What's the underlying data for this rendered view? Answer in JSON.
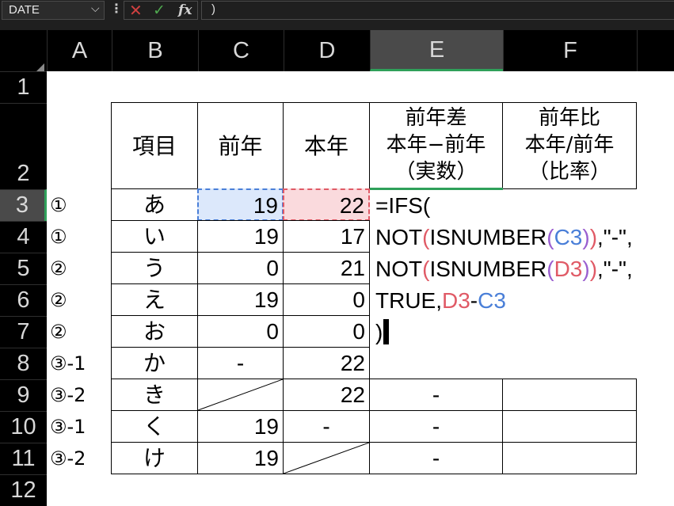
{
  "formula_bar": {
    "name_box": "DATE",
    "name_box_arrow": "⌵",
    "dots": "⋮",
    "cancel": "✕",
    "enter": "✓",
    "fx": "fx",
    "input": ")"
  },
  "columns": [
    "A",
    "B",
    "C",
    "D",
    "E",
    "F"
  ],
  "rows": [
    "1",
    "2",
    "3",
    "4",
    "5",
    "6",
    "7",
    "8",
    "9",
    "10",
    "11",
    "12"
  ],
  "table": {
    "header": {
      "item": "項目",
      "prev": "前年",
      "curr": "本年",
      "diff": [
        "前年差",
        "本年−前年",
        "（実数）"
      ],
      "ratio": [
        "前年比",
        "本年/前年",
        "（比率）"
      ]
    },
    "rows": [
      {
        "marker": "①",
        "item": "あ",
        "prev": "19",
        "curr": "22",
        "diff": "",
        "ratio": ""
      },
      {
        "marker": "①",
        "item": "い",
        "prev": "19",
        "curr": "17",
        "diff": "",
        "ratio": ""
      },
      {
        "marker": "②",
        "item": "う",
        "prev": "0",
        "curr": "21",
        "diff": "",
        "ratio": ""
      },
      {
        "marker": "②",
        "item": "え",
        "prev": "19",
        "curr": "0",
        "diff": "",
        "ratio": ""
      },
      {
        "marker": "②",
        "item": "お",
        "prev": "0",
        "curr": "0",
        "diff": "",
        "ratio": ""
      },
      {
        "marker": "③-1",
        "item": "か",
        "prev": "-",
        "curr": "22",
        "diff": "",
        "ratio": ""
      },
      {
        "marker": "③-2",
        "item": "き",
        "prev": "",
        "curr": "22",
        "diff": "-",
        "ratio": ""
      },
      {
        "marker": "③-1",
        "item": "く",
        "prev": "19",
        "curr": "-",
        "diff": "-",
        "ratio": ""
      },
      {
        "marker": "③-2",
        "item": "け",
        "prev": "19",
        "curr": "",
        "diff": "-",
        "ratio": ""
      }
    ]
  },
  "formula": {
    "line1": "=IFS(",
    "line2": {
      "a": "NOT",
      "b": "(",
      "c": "ISNUMBER",
      "d": "(",
      "ref": "C3",
      "e": ")",
      "f": ")",
      "g": ",\"-\","
    },
    "line3": {
      "a": "NOT",
      "b": "(",
      "c": "ISNUMBER",
      "d": "(",
      "ref": "D3",
      "e": ")",
      "f": ")",
      "g": ",\"-\","
    },
    "line4": {
      "a": "TRUE,",
      "ref1": "D3",
      "op": "-",
      "ref2": "C3"
    },
    "line5": ")"
  },
  "colors": {
    "ref_blue": "#4a7fd8",
    "ref_red": "#e05a66",
    "paren_purple": "#9a5fd0",
    "selected_header_accent": "#2fa05a",
    "c3_fill": "#dce8fb",
    "d3_fill": "#fadadd"
  }
}
